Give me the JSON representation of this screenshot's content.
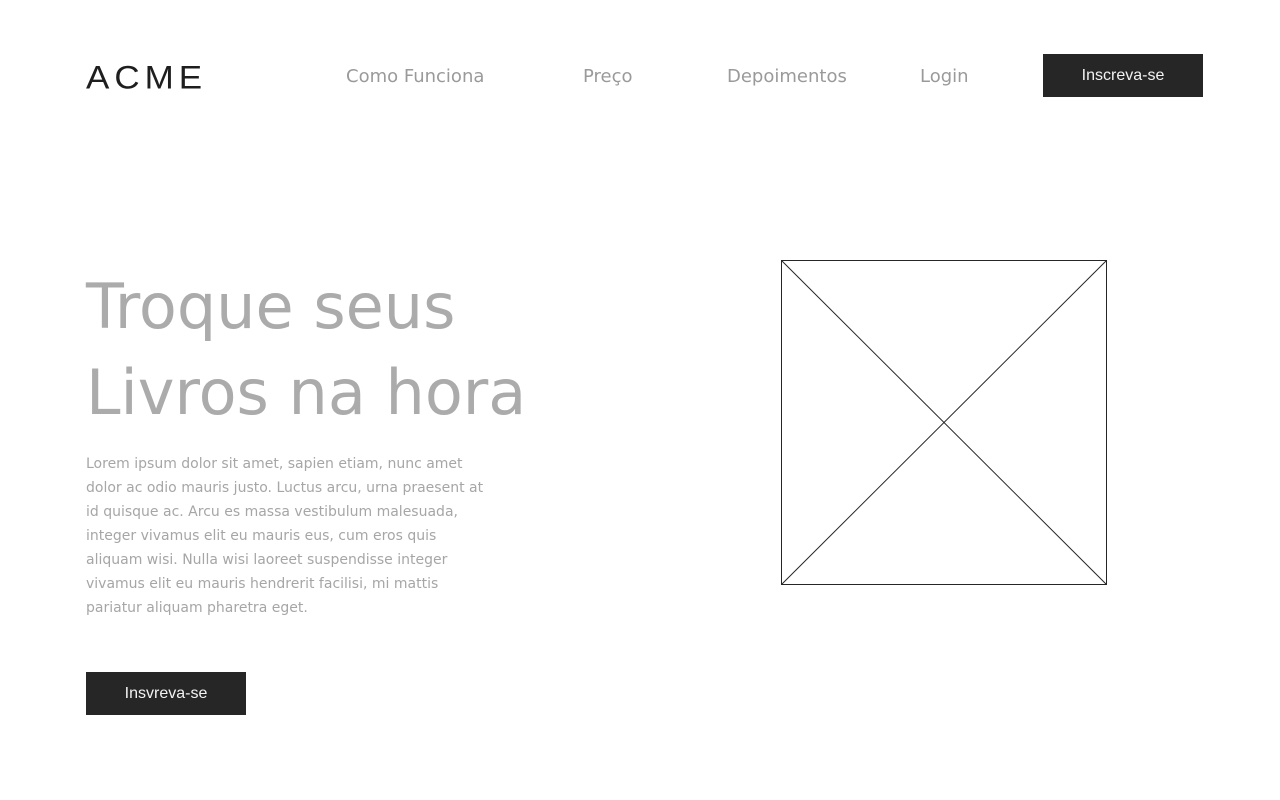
{
  "header": {
    "logo_text": "ACME",
    "nav": {
      "how_it_works": "Como Funciona",
      "price": "Preço",
      "testimonials": "Depoimentos",
      "login": "Login"
    },
    "signup_label": "Inscreva-se"
  },
  "hero": {
    "title_line1": "Troque seus",
    "title_line2": "Livros na hora",
    "body": "Lorem ipsum dolor sit amet, sapien etiam, nunc amet dolor ac odio mauris justo. Luctus arcu, urna praesent at id quisque ac. Arcu es massa vestibulum malesuada, integer vivamus elit eu mauris eus, cum eros quis aliquam wisi. Nulla wisi laoreet suspendisse integer vivamus elit eu mauris hendrerit facilisi, mi mattis pariatur aliquam pharetra eget.",
    "cta_label": "Insvreva-se"
  },
  "image": {
    "icon": "image-placeholder-icon"
  },
  "colors": {
    "button_bg": "#262626",
    "button_text": "#f2f2f2",
    "nav_text": "#9a9a9a",
    "title_text": "#ababab",
    "body_text": "#a6a6a6",
    "logo_text": "#1e1e1e"
  }
}
